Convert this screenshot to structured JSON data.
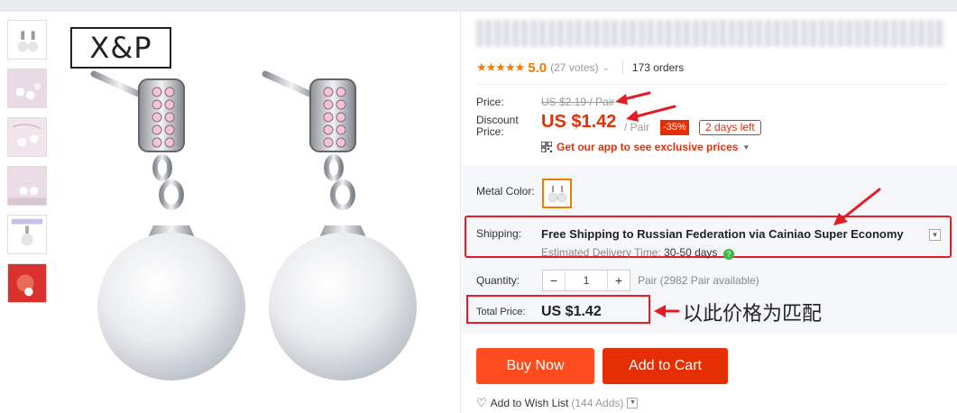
{
  "product": {
    "brand_logo": "X&P",
    "thumbnails": [
      "thumb-1",
      "thumb-2",
      "thumb-3",
      "thumb-4",
      "thumb-5",
      "thumb-6"
    ]
  },
  "rating": {
    "stars": "★★★★★",
    "value": "5.0",
    "votes": "(27 votes)",
    "orders": "173 orders"
  },
  "pricing": {
    "price_label": "Price:",
    "old_price": "US $2.19 / Pair",
    "discount_label": "Discount\nPrice:",
    "discount_price": "US $1.42",
    "unit": "/ Pair",
    "discount_badge": "-35%",
    "days_left": "2 days left",
    "app_promo": "Get our app to see exclusive prices"
  },
  "options": {
    "metal_color_label": "Metal Color:",
    "shipping_label": "Shipping:",
    "shipping_text": "Free Shipping to Russian Federation via Cainiao Super Economy",
    "eta_label": "Estimated Delivery Time:",
    "eta_value": "30-50 days",
    "quantity_label": "Quantity:",
    "quantity_value": "1",
    "minus": "−",
    "plus": "+",
    "available": "Pair (2982 Pair available)",
    "total_label": "Total Price:",
    "total_value": "US $1.42"
  },
  "annotation": {
    "note": "以此价格为匹配",
    "color": "#e41d24"
  },
  "actions": {
    "buy_now": "Buy Now",
    "add_to_cart": "Add to Cart",
    "wish_list": "Add to Wish List",
    "wish_adds": "(144 Adds)"
  },
  "colors": {
    "accent": "#e62e04",
    "buy_button": "#ff4c1e",
    "star": "#f07c00"
  }
}
